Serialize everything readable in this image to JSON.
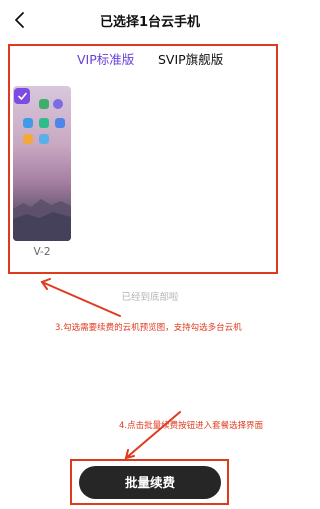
{
  "header": {
    "title": "已选择1台云手机"
  },
  "tabs": [
    {
      "label": "VIP标准版",
      "active": true
    },
    {
      "label": "SVIP旗舰版",
      "active": false
    }
  ],
  "phones": [
    {
      "label": "V-2",
      "selected": true
    }
  ],
  "list_end_text": "已经到底部啦",
  "annotations": {
    "step3": "3.勾选需要续费的云机预览图，支持勾选多台云机",
    "step4": "4.点击批量续费按钮进入套餐选择界面"
  },
  "batch_button": {
    "label": "批量续费"
  },
  "colors": {
    "accent_purple": "#6a3fd6",
    "annotation_red": "#e03a1e",
    "button_dark": "#262626"
  }
}
